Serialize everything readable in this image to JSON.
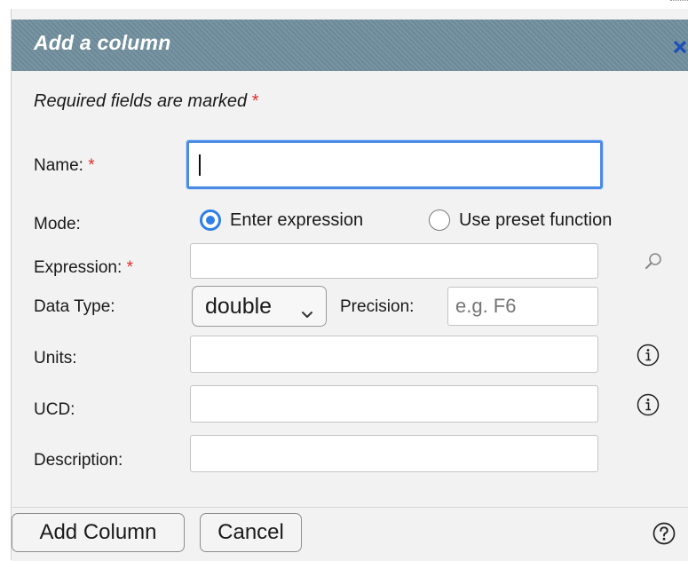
{
  "dialog": {
    "title": "Add a column",
    "close_icon": "close-icon",
    "required_note": "Required fields are marked",
    "required_star": "*"
  },
  "fields": {
    "name": {
      "label": "Name:",
      "value": ""
    },
    "mode": {
      "label": "Mode:",
      "options": [
        "Enter expression",
        "Use preset function"
      ],
      "selected": "Enter expression"
    },
    "expression": {
      "label": "Expression:",
      "value": "",
      "icon": "search-icon"
    },
    "data_type": {
      "label": "Data Type:",
      "value": "double"
    },
    "precision": {
      "label": "Precision:",
      "placeholder": "e.g. F6",
      "value": ""
    },
    "units": {
      "label": "Units:",
      "value": "",
      "icon": "info-icon"
    },
    "ucd": {
      "label": "UCD:",
      "value": "",
      "icon": "info-icon"
    },
    "description": {
      "label": "Description:",
      "value": ""
    }
  },
  "footer": {
    "add_label": "Add Column",
    "cancel_label": "Cancel",
    "help_icon": "help-icon"
  },
  "colors": {
    "titlebar": "#6f8d9c",
    "accent": "#2f7fe6",
    "required": "#e0302b"
  }
}
